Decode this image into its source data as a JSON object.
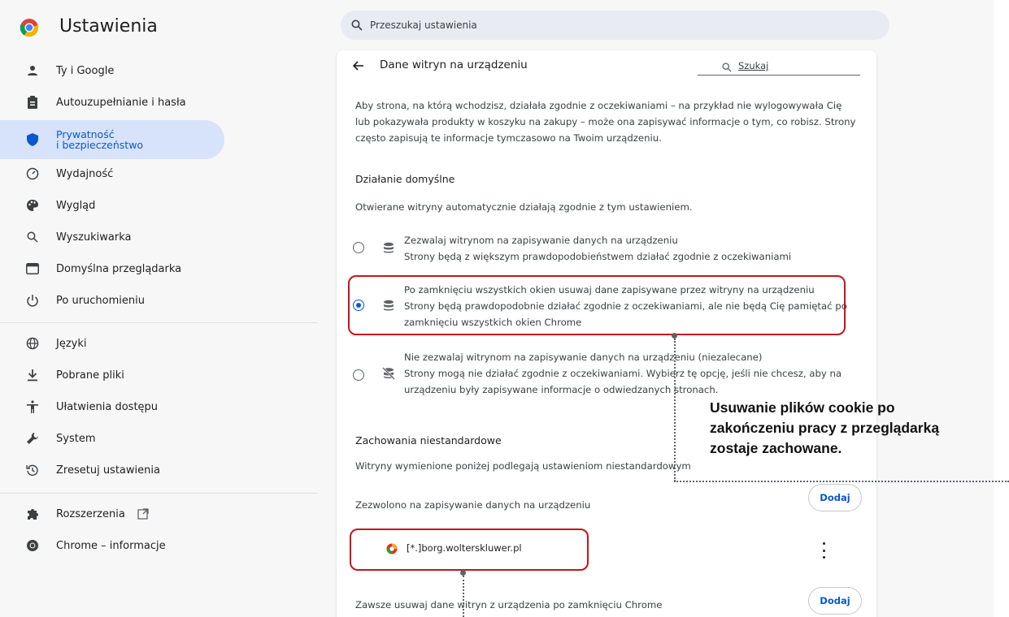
{
  "app": {
    "title": "Ustawienia"
  },
  "search": {
    "placeholder": "Przeszukaj ustawienia"
  },
  "sidebar": {
    "items": [
      {
        "label": "Ty i Google",
        "icon": "person-icon"
      },
      {
        "label": "Autouzupełnianie i hasła",
        "icon": "clipboard-icon"
      },
      {
        "label_line1": "Prywatność",
        "label_line2": "i bezpieczeństwo",
        "icon": "shield-icon",
        "active": true
      },
      {
        "label": "Wydajność",
        "icon": "speedometer-icon"
      },
      {
        "label": "Wygląd",
        "icon": "palette-icon"
      },
      {
        "label": "Wyszukiwarka",
        "icon": "search-icon"
      },
      {
        "label": "Domyślna przeglądarka",
        "icon": "browser-window-icon"
      },
      {
        "label": "Po uruchomieniu",
        "icon": "power-icon"
      },
      {
        "label": "Języki",
        "icon": "globe-icon"
      },
      {
        "label": "Pobrane pliki",
        "icon": "download-icon"
      },
      {
        "label": "Ułatwienia dostępu",
        "icon": "accessibility-icon"
      },
      {
        "label": "System",
        "icon": "wrench-icon"
      },
      {
        "label": "Zresetuj ustawienia",
        "icon": "history-icon"
      },
      {
        "label": "Rozszerzenia",
        "icon": "puzzle-icon"
      },
      {
        "label": "Chrome – informacje",
        "icon": "chrome-icon"
      }
    ]
  },
  "main": {
    "title": "Dane witryn na urządzeniu",
    "search_placeholder": "Szukaj",
    "intro": "Aby strona, na którą wchodzisz, działała zgodnie z oczekiwaniami – na przykład nie wylogowywała Cię lub pokazywała produkty w koszyku na zakupy – może ona zapisywać informacje o tym, co robisz. Strony często zapisują te informacje tymczasowo na Twoim urządzeniu.",
    "default_behavior": {
      "title": "Działanie domyślne",
      "subtitle": "Otwierane witryny automatycznie działają zgodnie z tym ustawieniem.",
      "options": [
        {
          "title": "Zezwalaj witrynom na zapisywanie danych na urządzeniu",
          "desc": "Strony będą z większym prawdopodobieństwem działać zgodnie z oczekiwaniami",
          "selected": false,
          "icon": "database-icon"
        },
        {
          "title": "Po zamknięciu wszystkich okien usuwaj dane zapisywane przez witryny na urządzeniu",
          "desc": "Strony będą prawdopodobnie działać zgodnie z oczekiwaniami, ale nie będą Cię pamiętać po zamknięciu wszystkich okien Chrome",
          "selected": true,
          "icon": "database-icon"
        },
        {
          "title": "Nie zezwalaj witrynom na zapisywanie danych na urządzeniu (niezalecane)",
          "desc": "Strony mogą nie działać zgodnie z oczekiwaniami. Wybierz tę opcję, jeśli nie chcesz, aby na urządzeniu były zapisywane informacje o odwiedzanych stronach.",
          "selected": false,
          "icon": "database-off-icon"
        }
      ]
    },
    "custom": {
      "title": "Zachowania niestandardowe",
      "subtitle": "Witryny wymienione poniżej podlegają ustawieniom niestandardowym",
      "allowed_label": "Zezwolono na zapisywanie danych na urządzeniu",
      "add_label": "Dodaj",
      "site": "[*.]borg.wolterskluwer.pl",
      "always_clear_label": "Zawsze usuwaj dane witryn z urządzenia po zamknięciu Chrome"
    }
  },
  "callout": {
    "line1": "Usuwanie plików cookie po",
    "line2": "zakończeniu pracy z przeglądarką",
    "line3": "zostaje zachowane."
  },
  "colors": {
    "accent": "#0b57d0",
    "highlight": "#c4161c",
    "active_bg": "#d7e3fb"
  }
}
